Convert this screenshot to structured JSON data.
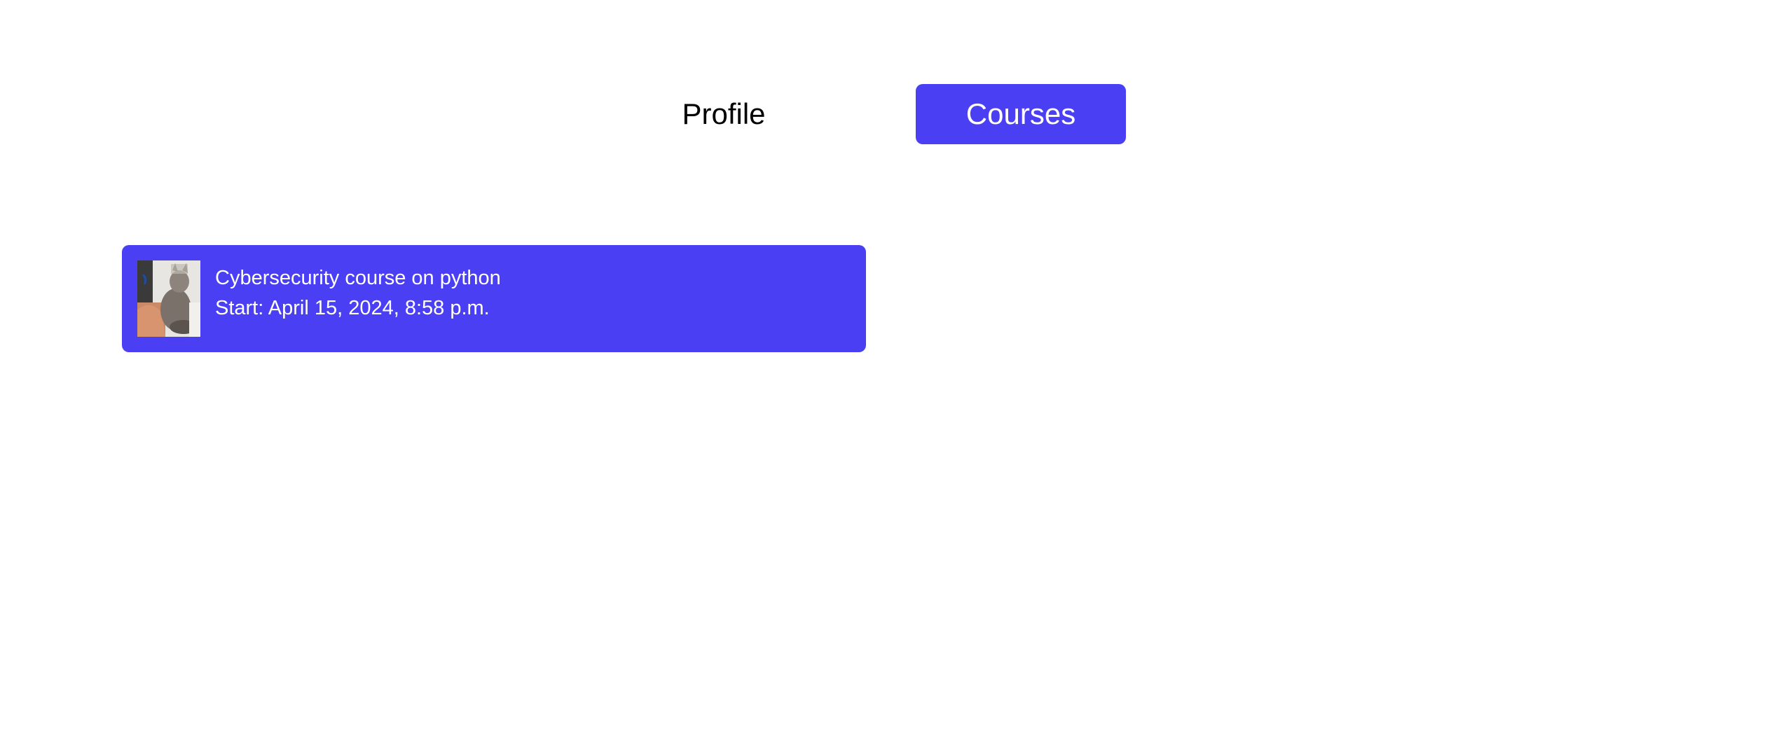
{
  "nav": {
    "profile_label": "Profile",
    "courses_label": "Courses"
  },
  "courses": [
    {
      "title": "Cybersecurity course on python",
      "start": "Start: April 15, 2024, 8:58 p.m.",
      "thumbnail": "course-photo"
    }
  ],
  "colors": {
    "accent": "#4b3ff4",
    "text_on_accent": "#ffffff",
    "text": "#000000",
    "background": "#ffffff"
  }
}
